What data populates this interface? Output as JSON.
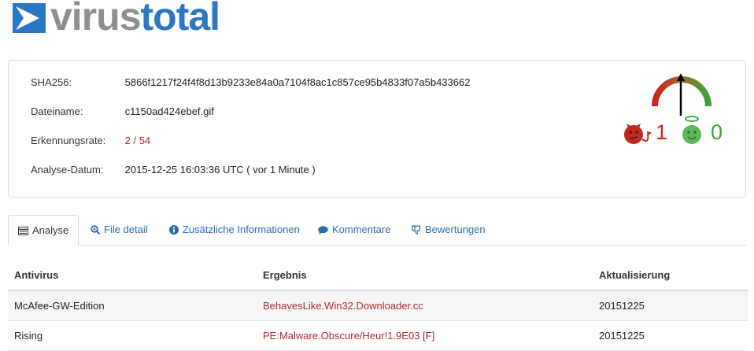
{
  "logo": {
    "part1": "virus",
    "part2": "total"
  },
  "summary": {
    "sha_label": "SHA256:",
    "sha_value": "5866f1217f24f4f8d13b9233e84a0a7104f8ac1c857ce95b4833f07a5b433662",
    "filename_label": "Dateiname:",
    "filename_value": "c1150ad424ebef.gif",
    "rate_label": "Erkennungsrate:",
    "rate_value": "2 / 54",
    "date_label": "Analyse-Datum:",
    "date_value": "2015-12-25 16:03:36 UTC ( vor 1 Minute )"
  },
  "votes": {
    "malicious": "1",
    "harmless": "0"
  },
  "colors": {
    "brand_gray": "#8d9091",
    "brand_blue": "#2b77c3",
    "danger": "#b2292e",
    "good": "#3aa33a"
  },
  "tabs": [
    {
      "label": "Analyse",
      "icon": "table-icon"
    },
    {
      "label": "File detail",
      "icon": "zoom-icon"
    },
    {
      "label": "Zusätzliche Informationen",
      "icon": "info-icon"
    },
    {
      "label": "Kommentare",
      "icon": "comment-icon"
    },
    {
      "label": "Bewertungen",
      "icon": "thumbs-icon"
    }
  ],
  "table": {
    "headers": [
      "Antivirus",
      "Ergebnis",
      "Aktualisierung"
    ],
    "rows": [
      {
        "antivirus": "McAfee-GW-Edition",
        "result": "BehavesLike.Win32.Downloader.cc",
        "updated": "20151225"
      },
      {
        "antivirus": "Rising",
        "result": "PE:Malware.Obscure/Heur!1.9E03 [F]",
        "updated": "20151225"
      }
    ]
  }
}
